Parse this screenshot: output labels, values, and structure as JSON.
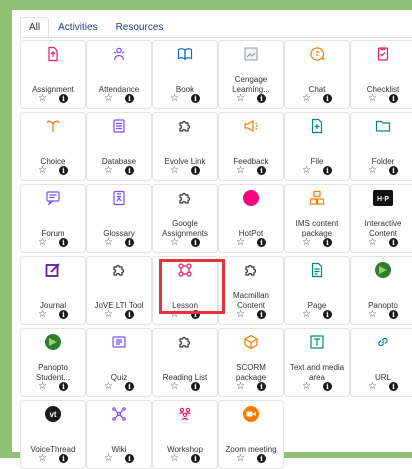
{
  "tabs": [
    {
      "label": "All",
      "active": true
    },
    {
      "label": "Activities",
      "active": false
    },
    {
      "label": "Resources",
      "active": false
    }
  ],
  "modules": [
    {
      "name": "Assignment",
      "icon": "assignment-icon",
      "color": "#e91e63"
    },
    {
      "name": "Attendance",
      "icon": "attendance-icon",
      "color": "#7c4dff"
    },
    {
      "name": "Book",
      "icon": "book-icon",
      "color": "#0f6cbf"
    },
    {
      "name": "Cengage Learning...",
      "icon": "broken-image-icon",
      "color": "#8a8a8a"
    },
    {
      "name": "Chat",
      "icon": "chat-icon",
      "color": "#f57c00"
    },
    {
      "name": "Checklist",
      "icon": "checklist-icon",
      "color": "#e91e63"
    },
    {
      "name": "Choice",
      "icon": "choice-icon",
      "color": "#f57c00"
    },
    {
      "name": "Database",
      "icon": "database-icon",
      "color": "#7c4dff"
    },
    {
      "name": "Evolve Link",
      "icon": "puzzle-icon",
      "color": "#333333"
    },
    {
      "name": "Feedback",
      "icon": "feedback-icon",
      "color": "#f57c00"
    },
    {
      "name": "File",
      "icon": "file-icon",
      "color": "#00897b"
    },
    {
      "name": "Folder",
      "icon": "folder-icon",
      "color": "#00897b"
    },
    {
      "name": "Forum",
      "icon": "forum-icon",
      "color": "#7c4dff"
    },
    {
      "name": "Glossary",
      "icon": "glossary-icon",
      "color": "#7c4dff"
    },
    {
      "name": "Google Assignments",
      "icon": "puzzle-icon",
      "color": "#333333"
    },
    {
      "name": "HotPot",
      "icon": "hotpot-icon",
      "color": "#ff0080"
    },
    {
      "name": "IMS content package",
      "icon": "ims-package-icon",
      "color": "#f57c00"
    },
    {
      "name": "Interactive Content",
      "icon": "h5p-icon",
      "color": "#111111"
    },
    {
      "name": "Journal",
      "icon": "journal-icon",
      "color": "#6a1b9a"
    },
    {
      "name": "JoVE LTI Tool",
      "icon": "puzzle-icon",
      "color": "#333333"
    },
    {
      "name": "Lesson",
      "icon": "lesson-icon",
      "color": "#e91e63"
    },
    {
      "name": "Macmillan Content",
      "icon": "puzzle-icon",
      "color": "#333333"
    },
    {
      "name": "Page",
      "icon": "page-icon",
      "color": "#00897b"
    },
    {
      "name": "Panopto",
      "icon": "panopto-icon",
      "color": "#2e7d32"
    },
    {
      "name": "Panopto Student...",
      "icon": "panopto-icon",
      "color": "#2e7d32"
    },
    {
      "name": "Quiz",
      "icon": "quiz-icon",
      "color": "#7c4dff"
    },
    {
      "name": "Reading List",
      "icon": "puzzle-icon",
      "color": "#333333"
    },
    {
      "name": "SCORM package",
      "icon": "scorm-icon",
      "color": "#f57c00"
    },
    {
      "name": "Text and media area",
      "icon": "text-media-icon",
      "color": "#00897b"
    },
    {
      "name": "URL",
      "icon": "url-icon",
      "color": "#00897b"
    },
    {
      "name": "VoiceThread",
      "icon": "voicethread-icon",
      "color": "#1a1a1a"
    },
    {
      "name": "Wiki",
      "icon": "wiki-icon",
      "color": "#7c4dff"
    },
    {
      "name": "Workshop",
      "icon": "workshop-icon",
      "color": "#e91e63"
    },
    {
      "name": "Zoom meeting",
      "icon": "zoom-icon",
      "color": "#f57c00"
    }
  ],
  "highlight_color": "#e33437",
  "frame_color": "#8fc073"
}
